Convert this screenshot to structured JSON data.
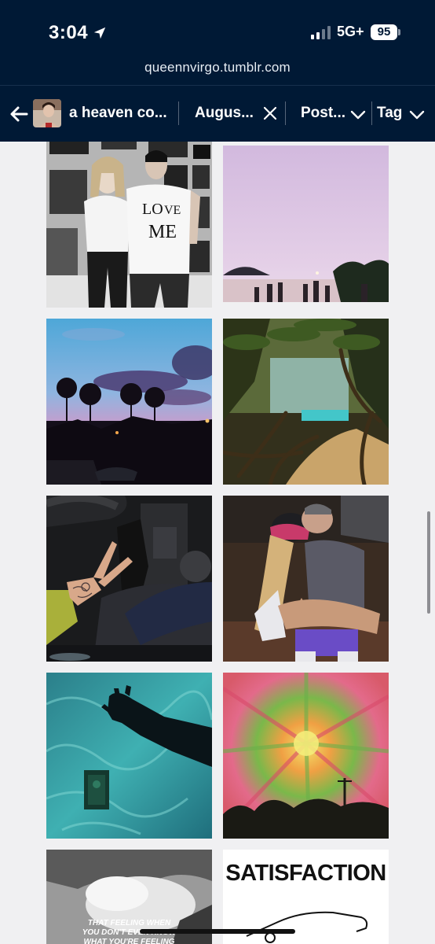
{
  "status": {
    "time": "3:04",
    "network": "5G+",
    "battery": "95"
  },
  "browser": {
    "url": "queennvirgo.tumblr.com"
  },
  "filters": {
    "blog_title": "a heaven co...",
    "date_chip": "Augus...",
    "type_chip": "Post...",
    "tag_chip": "Tag"
  },
  "posts": {
    "meme_caption_1": "THAT FEELING WHEN",
    "meme_caption_2": "YOU DON'T EVEN KNOW",
    "meme_caption_3": "WHAT YOU'RE FEELING",
    "poster_title": "SATISFACTION"
  },
  "theme": {
    "bar_color": "#001935",
    "page_bg": "#f0f0f2"
  }
}
